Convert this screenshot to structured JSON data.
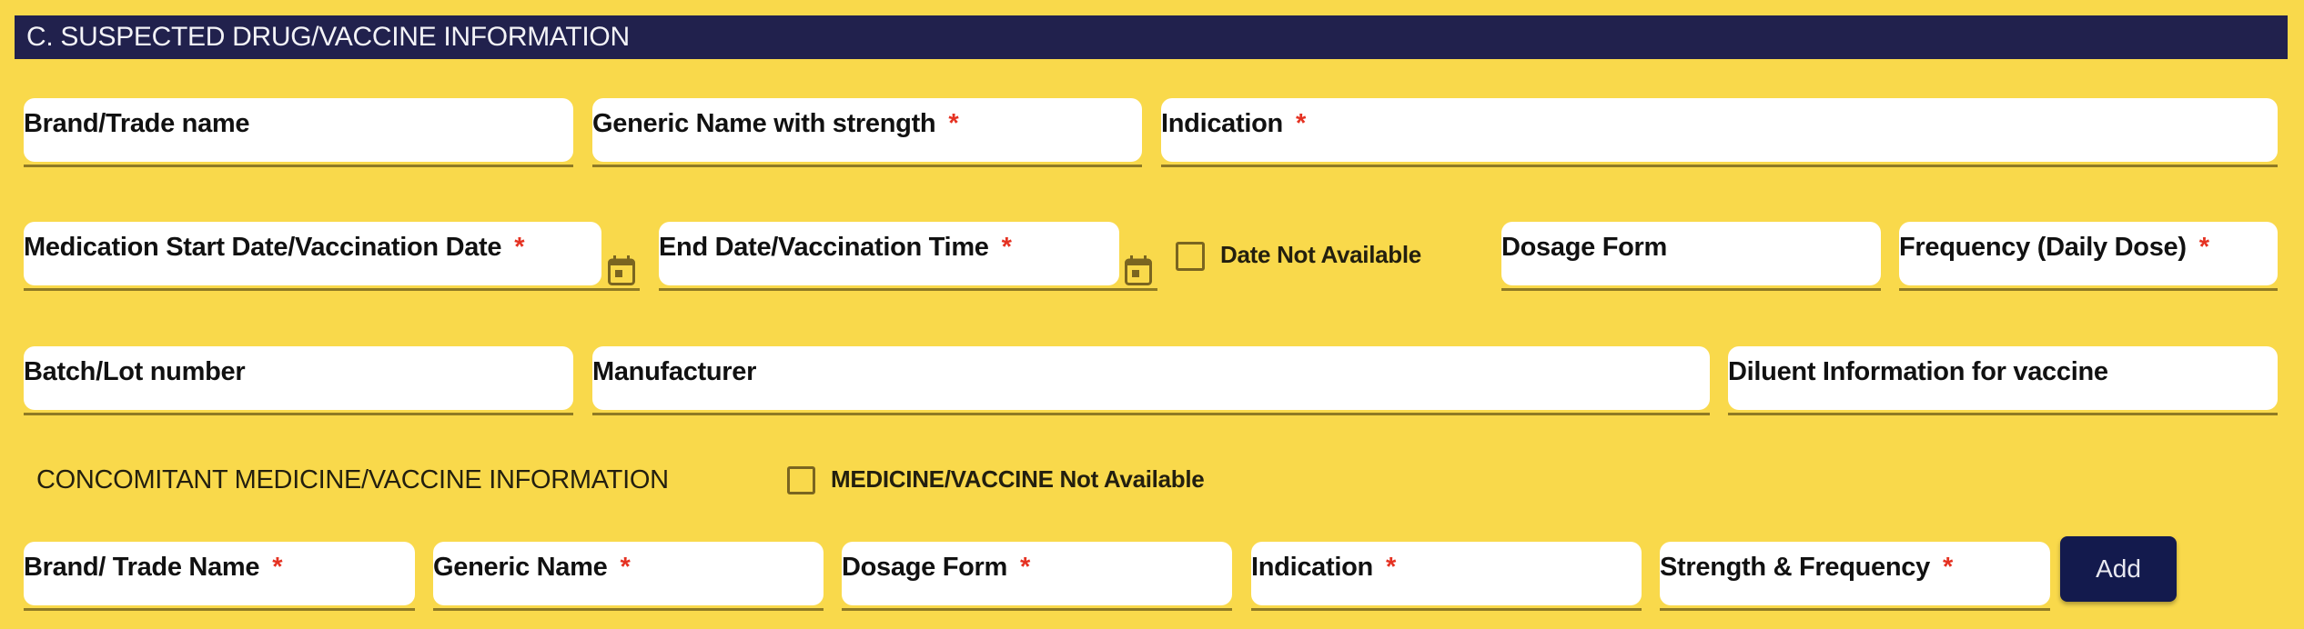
{
  "section": {
    "title": "C. SUSPECTED DRUG/VACCINE INFORMATION",
    "fields": {
      "brand_trade_name": {
        "label": "Brand/Trade name",
        "required": false,
        "value": ""
      },
      "generic_name_strength": {
        "label": "Generic Name with strength",
        "required": true,
        "value": ""
      },
      "indication": {
        "label": "Indication",
        "required": true,
        "value": ""
      },
      "start_date": {
        "label": "Medication Start Date/Vaccination Date",
        "required": true,
        "value": "",
        "icon": "calendar-icon"
      },
      "end_date": {
        "label": "End Date/Vaccination Time",
        "required": true,
        "value": "",
        "icon": "calendar-icon"
      },
      "date_not_available": {
        "label": "Date Not Available",
        "checked": false
      },
      "dosage_form": {
        "label": "Dosage Form",
        "required": false,
        "value": ""
      },
      "frequency": {
        "label": "Frequency (Daily Dose)",
        "required": true,
        "value": ""
      },
      "batch_lot": {
        "label": "Batch/Lot number",
        "required": false,
        "value": ""
      },
      "manufacturer": {
        "label": "Manufacturer",
        "required": false,
        "value": ""
      },
      "diluent": {
        "label": "Diluent Information for vaccine",
        "required": false,
        "value": ""
      }
    }
  },
  "concomitant": {
    "title": "CONCOMITANT MEDICINE/VACCINE INFORMATION",
    "not_available": {
      "label": "MEDICINE/VACCINE Not Available",
      "checked": false
    },
    "fields": {
      "brand_trade_name": {
        "label": "Brand/ Trade Name",
        "required": true,
        "value": ""
      },
      "generic_name": {
        "label": "Generic Name",
        "required": true,
        "value": ""
      },
      "dosage_form": {
        "label": "Dosage Form",
        "required": true,
        "value": ""
      },
      "indication": {
        "label": "Indication",
        "required": true,
        "value": ""
      },
      "strength_frequency": {
        "label": "Strength & Frequency",
        "required": true,
        "value": ""
      }
    },
    "add_button": "Add"
  },
  "required_marker": "*",
  "colors": {
    "background": "#f9d94b",
    "header_bar": "#21214d",
    "button": "#131a4d",
    "required": "#e53222",
    "underline": "#8f7a24"
  }
}
